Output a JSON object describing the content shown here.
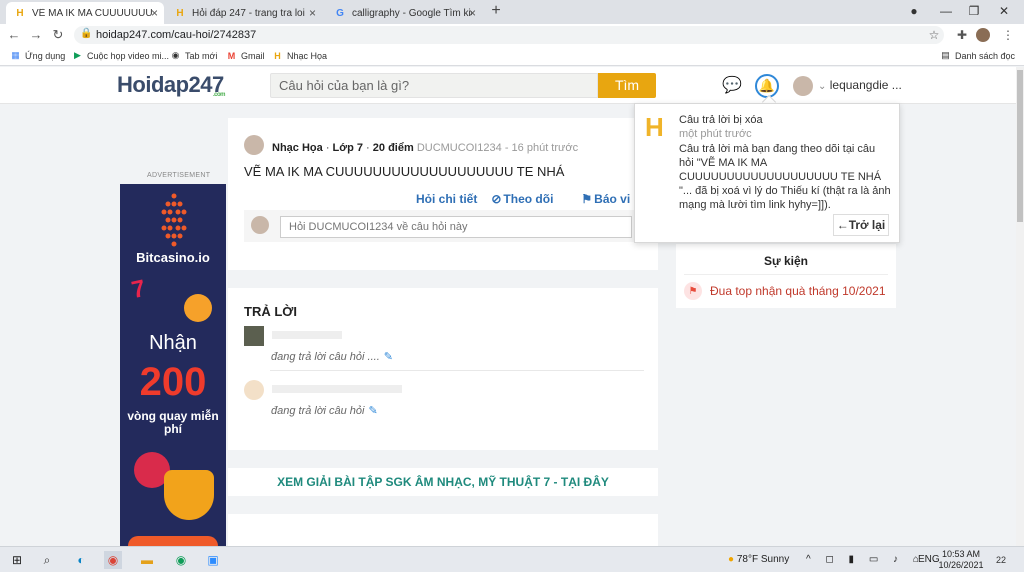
{
  "browser": {
    "tabs": [
      {
        "label": "VẼ MA IK MA CUUUUUUUUUUUUU",
        "favicon": "H"
      },
      {
        "label": "Hỏi đáp 247 - trang tra loi",
        "favicon": "H"
      },
      {
        "label": "calligraphy - Google Tìm kiếm",
        "favicon": "G"
      }
    ],
    "url": "hoidap247.com/cau-hoi/2742837",
    "bookmarks": [
      {
        "label": "Ứng dụng"
      },
      {
        "label": "Cuộc họp video mi..."
      },
      {
        "label": "Tab mới"
      },
      {
        "label": "Gmail"
      },
      {
        "label": "Nhạc Họa"
      }
    ],
    "reading_list": "Danh sách đọc"
  },
  "header": {
    "logo": "Hoidap247",
    "logo_sub": ".com",
    "search_placeholder": "Câu hỏi của bạn là gì?",
    "search_button": "Tìm",
    "username": "lequangdie ..."
  },
  "ad": {
    "label": "ADVERTISEMENT",
    "brand": "Bitcasino.io",
    "line1": "Nhận",
    "number": "200",
    "line2": "vòng quay miễn phí"
  },
  "question": {
    "subject": "Nhạc Họa",
    "grade": "Lớp 7",
    "points": "20 điểm",
    "author_time": "DUCMUCOI1234 - 16 phút trước",
    "title": "VẼ MA IK MA CUUUUUUUUUUUUUUUUUUU TE NHÁ",
    "actions": [
      "Hỏi chi tiết",
      "Theo dõi",
      "Báo vi phạm"
    ],
    "comment_placeholder": "Hỏi DUCMUCOI1234 về câu hỏi này"
  },
  "answers": {
    "title": "TRẢ LỜI",
    "items": [
      {
        "status": "đang trả lời câu hỏi ...."
      },
      {
        "status": "đang trả lời câu hỏi"
      }
    ]
  },
  "promo_link": "XEM GIẢI BÀI TẬP SGK ÂM NHẠC, MỸ THUẬT 7 - TẠI ĐÂY",
  "events": {
    "title": "Sự kiện",
    "item": "Đua top nhận quà tháng 10/2021"
  },
  "notification": {
    "title": "Câu trả lời bị xóa",
    "time": "một phút trước",
    "body": "Câu trả lời mà bạn đang theo dõi tại câu hỏi \"VẼ MA IK MA CUUUUUUUUUUUUUUUUUUU TE NHÁ \"... đã bị xoá vì lý do Thiếu kí (thật ra là ảnh mạng mà lười tìm link hyhy=]]).",
    "back": "Trở lại"
  },
  "taskbar": {
    "weather": "78°F  Sunny",
    "lang": "ENG",
    "time": "10:53 AM",
    "date": "10/26/2021",
    "badge": "22"
  },
  "colors": {
    "accent": "#e8a610",
    "link": "#2f6fb5",
    "teal": "#1f8a7d",
    "ad_bg": "#232a5c"
  }
}
